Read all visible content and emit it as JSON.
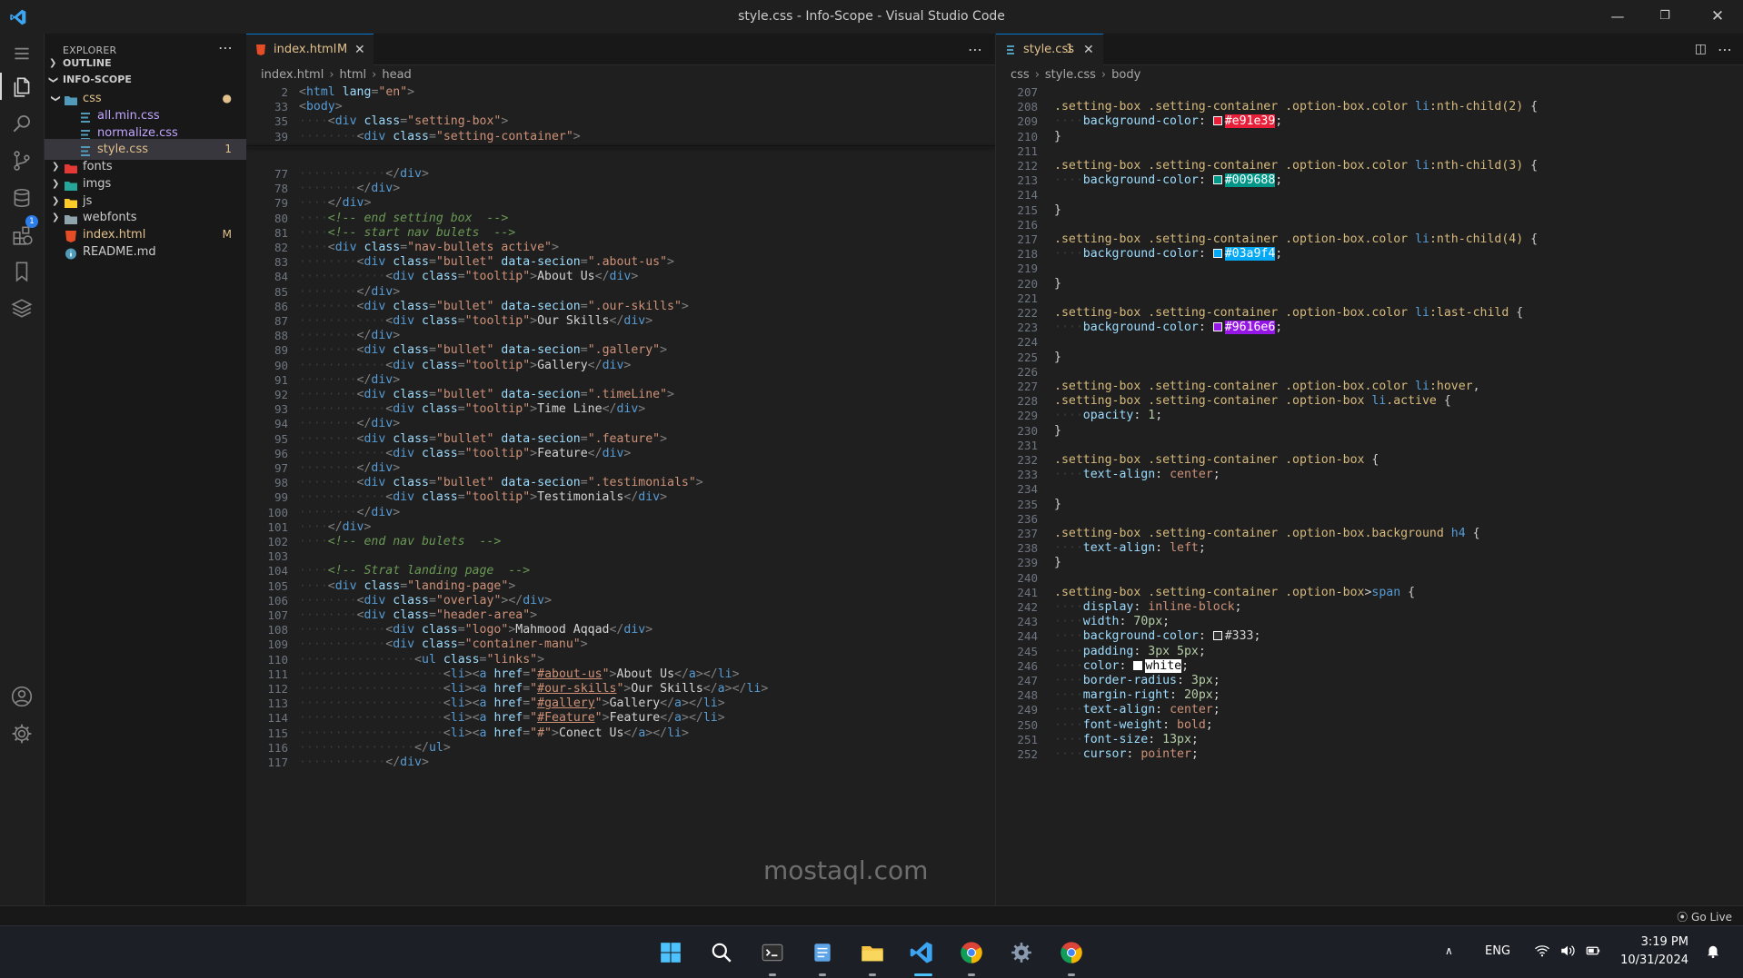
{
  "window": {
    "title": "style.css - Info-Scope - Visual Studio Code"
  },
  "explorer": {
    "title": "EXPLORER",
    "outline_label": "OUTLINE",
    "project_label": "INFO-SCOPE",
    "tree": [
      {
        "name": "css",
        "type": "folder-open",
        "level": 1,
        "badge": "●",
        "status": "modified"
      },
      {
        "name": "all.min.css",
        "type": "css",
        "level": 2,
        "badge": ""
      },
      {
        "name": "normalize.css",
        "type": "css",
        "level": 2,
        "badge": ""
      },
      {
        "name": "style.css",
        "type": "css",
        "level": 2,
        "badge": "1",
        "status": "modified",
        "selected": true
      },
      {
        "name": "fonts",
        "type": "folder",
        "level": 1,
        "badge": ""
      },
      {
        "name": "imgs",
        "type": "folder",
        "level": 1,
        "badge": ""
      },
      {
        "name": "js",
        "type": "folder",
        "level": 1,
        "badge": ""
      },
      {
        "name": "webfonts",
        "type": "folder",
        "level": 1,
        "badge": ""
      },
      {
        "name": "index.html",
        "type": "html",
        "level": 1,
        "badge": "M",
        "status": "modified"
      },
      {
        "name": "README.md",
        "type": "info",
        "level": 1,
        "badge": ""
      }
    ]
  },
  "left_editor": {
    "tab_label": "index.html",
    "tab_badge": "M",
    "breadcrumb": [
      "index.html",
      "html",
      "head"
    ],
    "sticky": [
      {
        "n": "2",
        "t": "<html lang=\"en\">"
      },
      {
        "n": "33",
        "t": "<body>"
      },
      {
        "n": "35",
        "t": "    <div class=\"setting-box\">"
      },
      {
        "n": "39",
        "t": "        <div class=\"setting-container\">"
      }
    ],
    "lines": [
      {
        "n": "77",
        "t": "            </div>"
      },
      {
        "n": "78",
        "t": "        </div>"
      },
      {
        "n": "79",
        "t": "    </div>"
      },
      {
        "n": "80",
        "t": "    <!-- end setting box  -->"
      },
      {
        "n": "81",
        "t": "    <!-- start nav bulets  -->"
      },
      {
        "n": "82",
        "t": "    <div class=\"nav-bullets active\">"
      },
      {
        "n": "83",
        "t": "        <div class=\"bullet\" data-secion=\".about-us\">"
      },
      {
        "n": "84",
        "t": "            <div class=\"tooltip\">About Us</div>"
      },
      {
        "n": "85",
        "t": "        </div>"
      },
      {
        "n": "86",
        "t": "        <div class=\"bullet\" data-secion=\".our-skills\">"
      },
      {
        "n": "87",
        "t": "            <div class=\"tooltip\">Our Skills</div>"
      },
      {
        "n": "88",
        "t": "        </div>"
      },
      {
        "n": "89",
        "t": "        <div class=\"bullet\" data-secion=\".gallery\">"
      },
      {
        "n": "90",
        "t": "            <div class=\"tooltip\">Gallery</div>"
      },
      {
        "n": "91",
        "t": "        </div>"
      },
      {
        "n": "92",
        "t": "        <div class=\"bullet\" data-secion=\".timeLine\">"
      },
      {
        "n": "93",
        "t": "            <div class=\"tooltip\">Time Line</div>"
      },
      {
        "n": "94",
        "t": "        </div>"
      },
      {
        "n": "95",
        "t": "        <div class=\"bullet\" data-secion=\".feature\">"
      },
      {
        "n": "96",
        "t": "            <div class=\"tooltip\">Feature</div>"
      },
      {
        "n": "97",
        "t": "        </div>"
      },
      {
        "n": "98",
        "t": "        <div class=\"bullet\" data-secion=\".testimonials\">"
      },
      {
        "n": "99",
        "t": "            <div class=\"tooltip\">Testimonials</div>"
      },
      {
        "n": "100",
        "t": "        </div>"
      },
      {
        "n": "101",
        "t": "    </div>"
      },
      {
        "n": "102",
        "t": "    <!-- end nav bulets  -->"
      },
      {
        "n": "103",
        "t": ""
      },
      {
        "n": "104",
        "t": "    <!-- Strat landing page  -->"
      },
      {
        "n": "105",
        "t": "    <div class=\"landing-page\">"
      },
      {
        "n": "106",
        "t": "        <div class=\"overlay\"></div>"
      },
      {
        "n": "107",
        "t": "        <div class=\"header-area\">"
      },
      {
        "n": "108",
        "t": "            <div class=\"logo\">Mahmood Aqqad</div>"
      },
      {
        "n": "109",
        "t": "            <div class=\"container-manu\">"
      },
      {
        "n": "110",
        "t": "                <ul class=\"links\">"
      },
      {
        "n": "111",
        "t": "                    <li><a href=\"#about-us\">About Us</a></li>"
      },
      {
        "n": "112",
        "t": "                    <li><a href=\"#our-skills\">Our Skills</a></li>"
      },
      {
        "n": "113",
        "t": "                    <li><a href=\"#gallery\">Gallery</a></li>"
      },
      {
        "n": "114",
        "t": "                    <li><a href=\"#Feature\">Feature</a></li>"
      },
      {
        "n": "115",
        "t": "                    <li><a href=\"#\">Conect Us</a></li>"
      },
      {
        "n": "116",
        "t": "                </ul>"
      },
      {
        "n": "117",
        "t": "            </div>"
      }
    ]
  },
  "right_editor": {
    "tab_label": "style.css",
    "tab_badge": "1",
    "breadcrumb": [
      "css",
      "style.css",
      "body"
    ],
    "lines": [
      {
        "n": "207",
        "t": ""
      },
      {
        "n": "208",
        "t": ".setting-box .setting-container .option-box.color li:nth-child(2) {"
      },
      {
        "n": "209",
        "t": "    background-color: #e91e39;",
        "swatch": "#e91e39"
      },
      {
        "n": "210",
        "t": "}"
      },
      {
        "n": "211",
        "t": ""
      },
      {
        "n": "212",
        "t": ".setting-box .setting-container .option-box.color li:nth-child(3) {"
      },
      {
        "n": "213",
        "t": "    background-color: #009688;",
        "swatch": "#009688"
      },
      {
        "n": "214",
        "t": ""
      },
      {
        "n": "215",
        "t": "}"
      },
      {
        "n": "216",
        "t": ""
      },
      {
        "n": "217",
        "t": ".setting-box .setting-container .option-box.color li:nth-child(4) {"
      },
      {
        "n": "218",
        "t": "    background-color: #03a9f4;",
        "swatch": "#03a9f4"
      },
      {
        "n": "219",
        "t": ""
      },
      {
        "n": "220",
        "t": "}"
      },
      {
        "n": "221",
        "t": ""
      },
      {
        "n": "222",
        "t": ".setting-box .setting-container .option-box.color li:last-child {"
      },
      {
        "n": "223",
        "t": "    background-color: #9616e6;",
        "swatch": "#9616e6"
      },
      {
        "n": "224",
        "t": ""
      },
      {
        "n": "225",
        "t": "}"
      },
      {
        "n": "226",
        "t": ""
      },
      {
        "n": "227",
        "t": ".setting-box .setting-container .option-box.color li:hover,"
      },
      {
        "n": "228",
        "t": ".setting-box .setting-container .option-box li.active {"
      },
      {
        "n": "229",
        "t": "    opacity: 1;"
      },
      {
        "n": "230",
        "t": "}"
      },
      {
        "n": "231",
        "t": ""
      },
      {
        "n": "232",
        "t": ".setting-box .setting-container .option-box {"
      },
      {
        "n": "233",
        "t": "    text-align: center;"
      },
      {
        "n": "234",
        "t": ""
      },
      {
        "n": "235",
        "t": "}"
      },
      {
        "n": "236",
        "t": ""
      },
      {
        "n": "237",
        "t": ".setting-box .setting-container .option-box.background h4 {"
      },
      {
        "n": "238",
        "t": "    text-align: left;"
      },
      {
        "n": "239",
        "t": "}"
      },
      {
        "n": "240",
        "t": ""
      },
      {
        "n": "241",
        "t": ".setting-box .setting-container .option-box>span {"
      },
      {
        "n": "242",
        "t": "    display: inline-block;"
      },
      {
        "n": "243",
        "t": "    width: 70px;"
      },
      {
        "n": "244",
        "t": "    background-color: #333;",
        "swatch": "#333333"
      },
      {
        "n": "245",
        "t": "    padding: 3px 5px;"
      },
      {
        "n": "246",
        "t": "    color: white;",
        "swatch": "#ffffff"
      },
      {
        "n": "247",
        "t": "    border-radius: 3px;"
      },
      {
        "n": "248",
        "t": "    margin-right: 20px;"
      },
      {
        "n": "249",
        "t": "    text-align: center;"
      },
      {
        "n": "250",
        "t": "    font-weight: bold;"
      },
      {
        "n": "251",
        "t": "    font-size: 13px;"
      },
      {
        "n": "252",
        "t": "    cursor: pointer;"
      }
    ]
  },
  "status": {
    "go_live": "Go Live"
  },
  "taskbar": {
    "language": "ENG",
    "time": "3:19 PM",
    "date": "10/31/2024"
  },
  "watermark": "mostaql.com"
}
